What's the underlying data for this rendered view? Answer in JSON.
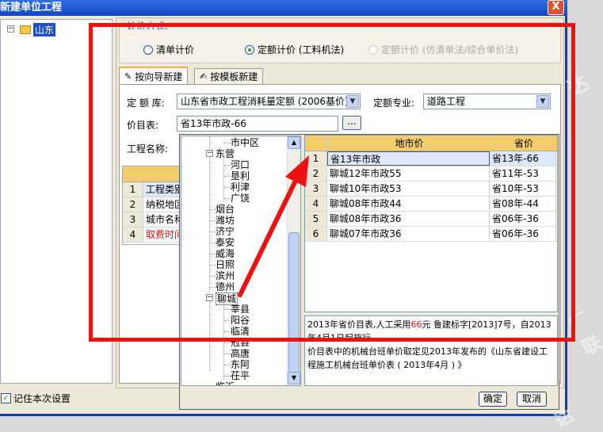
{
  "window": {
    "title": "新建单位工程",
    "close_symbol": "X"
  },
  "left_tree": {
    "root_label": "山东",
    "expander": "−"
  },
  "pricing_method": {
    "group_title": "计价方式:",
    "options": [
      {
        "label": "清单计价",
        "selected": false,
        "disabled": false
      },
      {
        "label": "定额计价 (工料机法)",
        "selected": true,
        "disabled": false
      },
      {
        "label": "定额计价 (仿清单法/综合单价法)",
        "selected": false,
        "disabled": true
      }
    ]
  },
  "tabs": [
    {
      "label": "按向导新建",
      "active": true,
      "icon": "wizard-icon"
    },
    {
      "label": "按模板新建",
      "active": false,
      "icon": "template-icon"
    }
  ],
  "form": {
    "quota_lib_label": "定 额 库:",
    "quota_lib_value": "山东省市政工程消耗量定额 (2006基价)",
    "quota_major_label": "定额专业:",
    "quota_major_value": "道路工程",
    "price_table_label": "价目表:",
    "price_table_value": "省13年市政-66",
    "browse_label": "...",
    "project_name_label": "工程名称:",
    "dropdown_arrow": "▼"
  },
  "project_grid": {
    "rows": [
      {
        "num": "1",
        "text": "工程类别",
        "red": false
      },
      {
        "num": "2",
        "text": "纳税地区",
        "red": false
      },
      {
        "num": "3",
        "text": "城市名称",
        "red": false
      },
      {
        "num": "4",
        "text": "取费时间",
        "red": true
      }
    ]
  },
  "region_tree": {
    "items": [
      {
        "label": "市中区",
        "level": 2
      },
      {
        "label": "东营",
        "level": 1,
        "expander": "−"
      },
      {
        "label": "河口",
        "level": 2
      },
      {
        "label": "垦利",
        "level": 2
      },
      {
        "label": "利津",
        "level": 2
      },
      {
        "label": "广饶",
        "level": 2
      },
      {
        "label": "烟台",
        "level": 1
      },
      {
        "label": "潍坊",
        "level": 1
      },
      {
        "label": "济宁",
        "level": 1
      },
      {
        "label": "泰安",
        "level": 1
      },
      {
        "label": "威海",
        "level": 1
      },
      {
        "label": "日照",
        "level": 1
      },
      {
        "label": "滨州",
        "level": 1
      },
      {
        "label": "德州",
        "level": 1
      },
      {
        "label": "聊城",
        "level": 1,
        "expander": "−",
        "highlight": true
      },
      {
        "label": "莘县",
        "level": 2
      },
      {
        "label": "阳谷",
        "level": 2
      },
      {
        "label": "临清",
        "level": 2
      },
      {
        "label": "冠县",
        "level": 2
      },
      {
        "label": "高唐",
        "level": 2
      },
      {
        "label": "东阿",
        "level": 2
      },
      {
        "label": "茌平",
        "level": 2
      },
      {
        "label": "临沂",
        "level": 1
      }
    ],
    "scroll_up": "▲",
    "scroll_down": "▼"
  },
  "price_list": {
    "columns": [
      "",
      "地市价",
      "省价"
    ],
    "rows": [
      {
        "num": "1",
        "city": "省13年市政",
        "province": "省13年-66",
        "selected": true
      },
      {
        "num": "2",
        "city": "聊城12年市政55",
        "province": "省11年-53",
        "selected": false
      },
      {
        "num": "3",
        "city": "聊城10年市政53",
        "province": "省10年-53",
        "selected": false
      },
      {
        "num": "4",
        "city": "聊城08年市政44",
        "province": "省08年-44",
        "selected": false
      },
      {
        "num": "5",
        "city": "聊城08年市政36",
        "province": "省06年-36",
        "selected": false
      },
      {
        "num": "6",
        "city": "聊城07年市政36",
        "province": "省06年-36",
        "selected": false
      }
    ]
  },
  "notes": {
    "note1_pre": "2013年省价目表,人工采用",
    "note1_highlight": "66",
    "note1_post": "元 鲁建标字[2013]7号，自2013年4月1日起施行",
    "note2": "价目表中的机械台班单价取定见2013年发布的《山东省建设工程施工机械台班单价表 ( 2013年4月 ) 》"
  },
  "popup_buttons": {
    "ok": "确定",
    "cancel": "取消"
  },
  "footer": {
    "remember_label": "记住本次设置",
    "remember_checked": true,
    "check_mark": "✓"
  },
  "colors": {
    "annotation_red": "#ee1111",
    "titlebar_blue": "#1146c4",
    "grid_header_gold": "#f3cc6b"
  }
}
